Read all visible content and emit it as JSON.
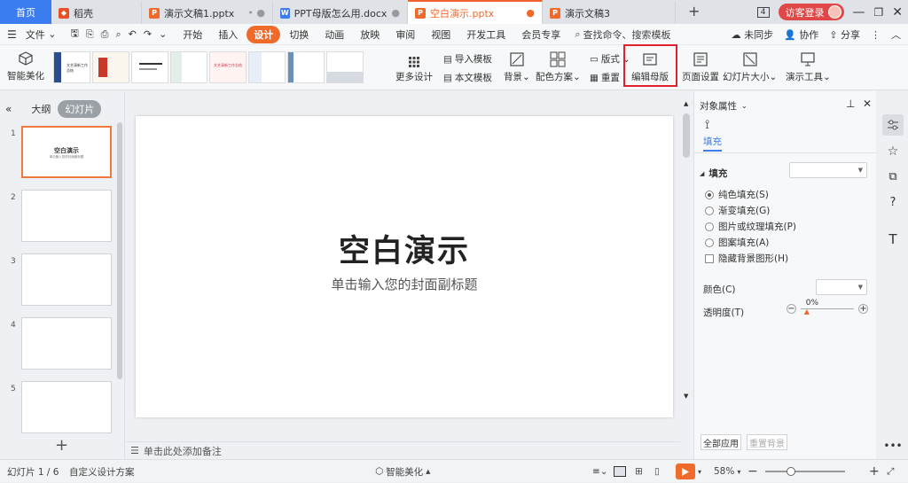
{
  "title_bar": {
    "home": "首页",
    "tabs": [
      {
        "title": "稻壳",
        "color": "#e8502a",
        "active": false
      },
      {
        "title": "演示文稿1.pptx",
        "color": "#f06a2c",
        "active": false
      },
      {
        "title": "PPT母版怎么用.docx",
        "color": "#3b7cf0",
        "active": false
      },
      {
        "title": "空白演示.pptx",
        "color": "#f06a2c",
        "active": true
      },
      {
        "title": "演示文稿3",
        "color": "#f06a2c",
        "active": false
      }
    ],
    "tab_count": "4",
    "login": "访客登录"
  },
  "menu": {
    "file": "文件",
    "items": [
      "开始",
      "插入",
      "设计",
      "切换",
      "动画",
      "放映",
      "审阅",
      "视图",
      "开发工具",
      "会员专享"
    ],
    "active": "设计",
    "search": "查找命令、搜索模板",
    "sync": "未同步",
    "collab": "协作",
    "share": "分享"
  },
  "ribbon": {
    "smart_beautify": "智能美化",
    "templates": [
      "文艺清新工作总结",
      "",
      "",
      "文艺清新工作总结",
      "",
      "",
      "",
      ""
    ],
    "more_design": "更多设计",
    "import_template": "导入模板",
    "text_template": "本文模板",
    "background": "背景",
    "color_scheme": "配色方案",
    "layout": "版式",
    "reset": "重置",
    "edit_master": "编辑母版",
    "page_setup": "页面设置",
    "slide_size": "幻灯片大小",
    "presentation_tools": "演示工具"
  },
  "left_panel": {
    "outline_tab": "大纲",
    "slides_tab": "幻灯片",
    "slides": [
      {
        "num": "1",
        "title": "空白演示",
        "subtitle": "单击输入您的封面副标题"
      },
      {
        "num": "2",
        "title": "",
        "subtitle": ""
      },
      {
        "num": "3",
        "title": "",
        "subtitle": ""
      },
      {
        "num": "4",
        "title": "",
        "subtitle": ""
      },
      {
        "num": "5",
        "title": "",
        "subtitle": ""
      }
    ]
  },
  "slide": {
    "title": "空白演示",
    "subtitle": "单击输入您的封面副标题",
    "notes_placeholder": "单击此处添加备注"
  },
  "properties": {
    "header": "对象属性",
    "tab": "填充",
    "section": "填充",
    "options": [
      "纯色填充(S)",
      "渐变填充(G)",
      "图片或纹理填充(P)",
      "图案填充(A)"
    ],
    "selected_option": 0,
    "hide_bg": "隐藏背景图形(H)",
    "color_label": "颜色(C)",
    "transparency_label": "透明度(T)",
    "transparency_value": "0%",
    "apply_all": "全部应用",
    "reset_bg": "重置背景"
  },
  "status": {
    "slide_pos": "幻灯片 1 / 6",
    "scheme": "自定义设计方案",
    "smart": "智能美化",
    "zoom": "58%"
  }
}
